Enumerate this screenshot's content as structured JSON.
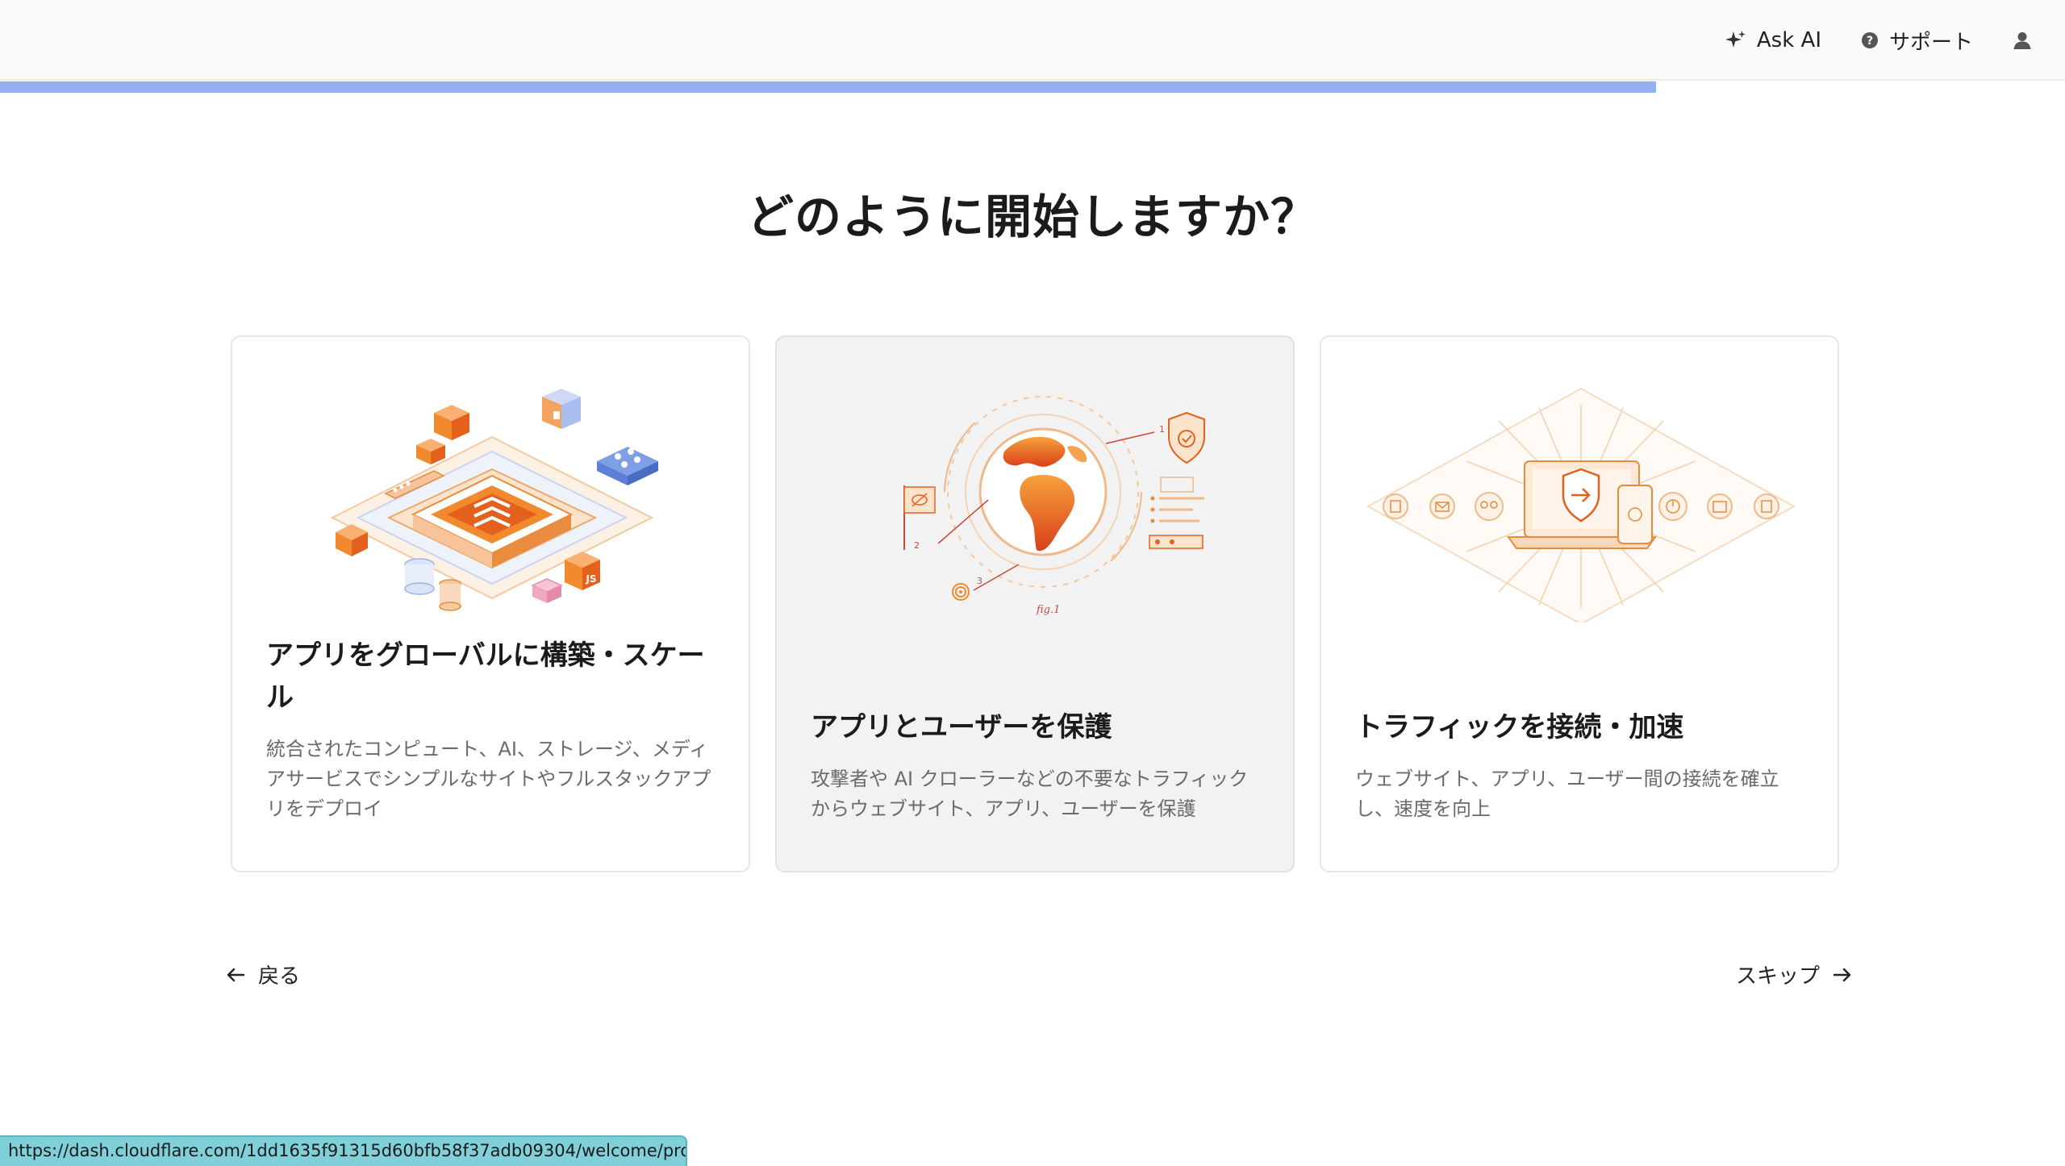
{
  "header": {
    "ask_ai_label": "Ask AI",
    "support_label": "サポート",
    "progress_value": 0.802
  },
  "page": {
    "title": "どのように開始しますか？"
  },
  "cards": [
    {
      "title": "アプリをグローバルに構築・スケール",
      "description": "統合されたコンピュート、AI、ストレージ、メディアサービスでシンプルなサイトやフルスタックアプリをデプロイ"
    },
    {
      "title": "アプリとユーザーを保護",
      "description": "攻撃者や AI クローラーなどの不要なトラフィックからウェブサイト、アプリ、ユーザーを保護"
    },
    {
      "title": "トラフィックを接続・加速",
      "description": "ウェブサイト、アプリ、ユーザー間の接続を確立し、速度を向上"
    }
  ],
  "illustration_labels": {
    "js_cube": "JS",
    "fig": "fig.1",
    "num1": "1",
    "num2": "2",
    "num3": "3"
  },
  "footer": {
    "back_label": "戻る",
    "skip_label": "スキップ"
  },
  "status_url": "https://dash.cloudflare.com/1dd1635f91315d60bfb58f37adb09304/welcome/pro...",
  "colors": {
    "accent_orange": "#f38020",
    "progress_blue": "#93b1f2",
    "url_bar": "#7fd0d8"
  }
}
